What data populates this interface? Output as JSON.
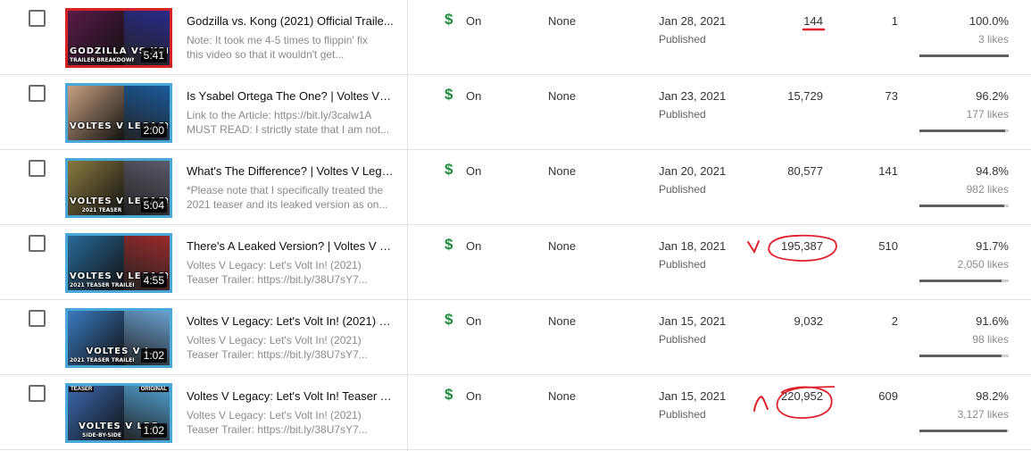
{
  "colors": {
    "monetization": "#1e8e3e",
    "annotation": "#e0202a",
    "thumb_border": "#4aa8d8",
    "bar_fill": "#606060"
  },
  "icons": {
    "checkbox": "checkbox-icon",
    "monetization": "dollar-icon",
    "annotation": "hand-drawn-red-marks"
  },
  "rows": [
    {
      "title": "Godzilla vs. Kong (2021) Official Traile...",
      "desc": [
        "Note: It took me 4-5 times to flippin' fix",
        "this video so that it wouldn't get..."
      ],
      "thumb": {
        "text": "GODZILLA VS KONG",
        "sub": "TRAILER BREAKDOWN",
        "duration": "5:41",
        "border": "#d42323",
        "c1": "#5a1a4a",
        "c2": "#2a2a8a"
      },
      "monetization_symbol": "$",
      "monetization": "On",
      "restrictions": "None",
      "date": "Jan 28, 2021",
      "status": "Published",
      "views": "144",
      "comments": "1",
      "like_pct": "100.0%",
      "likes": "3 likes",
      "like_ratio": 1.0
    },
    {
      "title": "Is Ysabel Ortega The One? | Voltes V L...",
      "desc": [
        "Link to the Article: https://bit.ly/3calw1A",
        "MUST READ: I strictly state that I am not..."
      ],
      "thumb": {
        "text": "VOLTES V LEGACY",
        "sub": "",
        "duration": "2:00",
        "border": "#4aa8d8",
        "c1": "#c8a080",
        "c2": "#1a5a9a"
      },
      "monetization_symbol": "$",
      "monetization": "On",
      "restrictions": "None",
      "date": "Jan 23, 2021",
      "status": "Published",
      "views": "15,729",
      "comments": "73",
      "like_pct": "96.2%",
      "likes": "177 likes",
      "like_ratio": 0.962
    },
    {
      "title": "What's The Difference? | Voltes V Lega...",
      "desc": [
        "*Please note that I specifically treated the",
        "2021 teaser and its leaked version as on..."
      ],
      "thumb": {
        "text": "VOLTES V LEGACY",
        "sub": "2021 TEASER",
        "duration": "5:04",
        "border": "#4aa8d8",
        "c1": "#8a7a40",
        "c2": "#5a5a6a"
      },
      "monetization_symbol": "$",
      "monetization": "On",
      "restrictions": "None",
      "date": "Jan 20, 2021",
      "status": "Published",
      "views": "80,577",
      "comments": "141",
      "like_pct": "94.8%",
      "likes": "982 likes",
      "like_ratio": 0.948
    },
    {
      "title": "There's A Leaked Version? | Voltes V L...",
      "desc": [
        "Voltes V Legacy: Let's Volt In! (2021)",
        "Teaser Trailer: https://bit.ly/38U7sY7..."
      ],
      "thumb": {
        "text": "VOLTES V LEGACY",
        "sub": "2021 TEASER TRAILER",
        "duration": "4:55",
        "border": "#4aa8d8",
        "c1": "#2a6a9a",
        "c2": "#9a2a2a"
      },
      "monetization_symbol": "$",
      "monetization": "On",
      "restrictions": "None",
      "date": "Jan 18, 2021",
      "status": "Published",
      "views": "195,387",
      "comments": "510",
      "like_pct": "91.7%",
      "likes": "2,050 likes",
      "like_ratio": 0.917
    },
    {
      "title": "Voltes V Legacy: Let's Volt In! (2021) | ...",
      "desc": [
        "Voltes V Legacy: Let's Volt In! (2021)",
        "Teaser Trailer: https://bit.ly/38U7sY7..."
      ],
      "thumb": {
        "text": "VOLTES V L",
        "sub": "2021 TEASER TRAILER",
        "duration": "1:02",
        "border": "#4aa8d8",
        "c1": "#3a7ac0",
        "c2": "#6aa0d0"
      },
      "monetization_symbol": "$",
      "monetization": "On",
      "restrictions": "None",
      "date": "Jan 15, 2021",
      "status": "Published",
      "views": "9,032",
      "comments": "2",
      "like_pct": "91.6%",
      "likes": "98 likes",
      "like_ratio": 0.916
    },
    {
      "title": "Voltes V Legacy: Let's Volt In! Teaser T...",
      "desc": [
        "Voltes V Legacy: Let's Volt In! (2021)",
        "Teaser Trailer: https://bit.ly/38U7sY7..."
      ],
      "thumb": {
        "text": "VOLTES V LEG",
        "sub": "SIDE-BY-SIDE",
        "duration": "1:02",
        "border": "#4aa8d8",
        "c1": "#3a6ab0",
        "c2": "#50a0d0",
        "tag_left": "TEASER",
        "tag_right": "ORIGINAL"
      },
      "monetization_symbol": "$",
      "monetization": "On",
      "restrictions": "None",
      "date": "Jan 15, 2021",
      "status": "Published",
      "views": "220,952",
      "comments": "609",
      "like_pct": "98.2%",
      "likes": "3,127 likes",
      "like_ratio": 0.982
    }
  ]
}
